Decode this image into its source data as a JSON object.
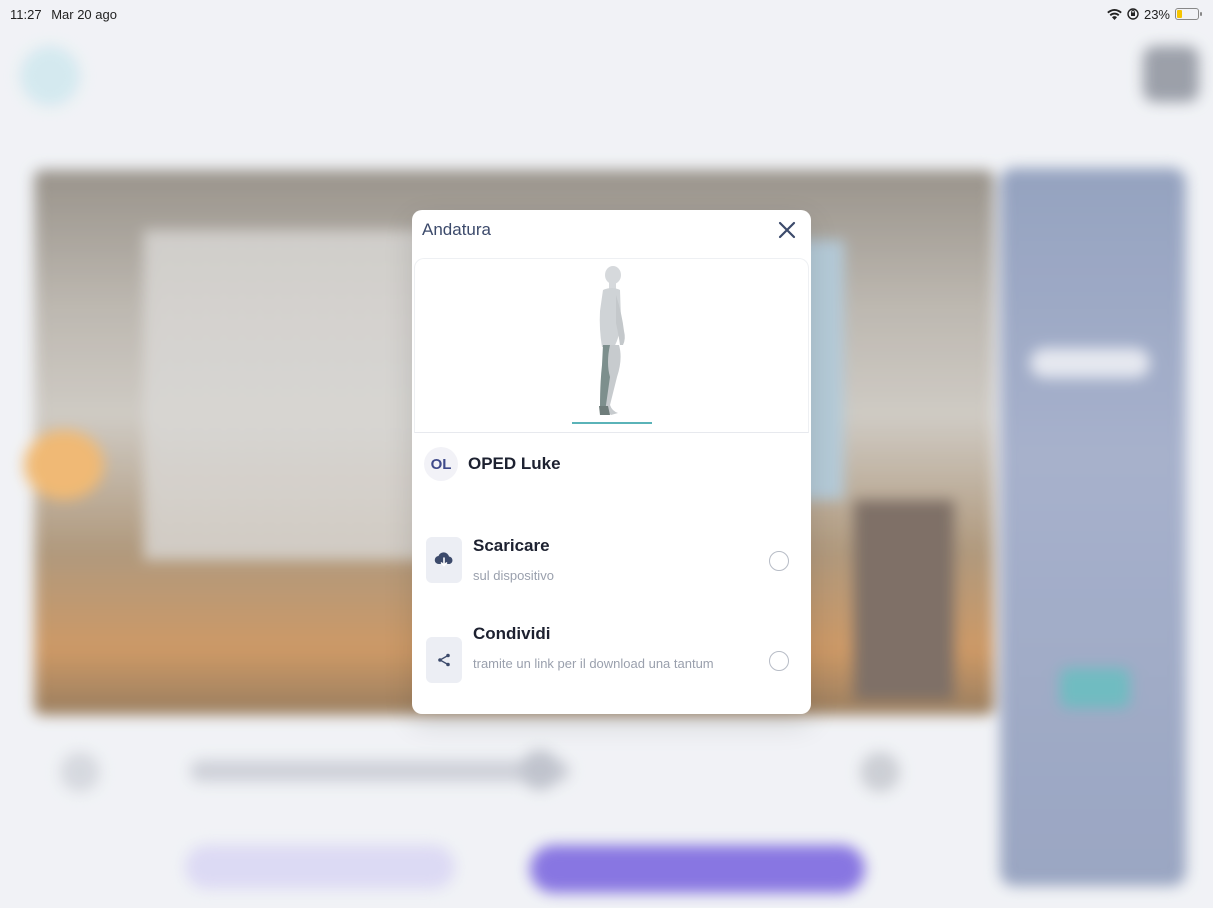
{
  "status_bar": {
    "time": "11:27",
    "date": "Mar 20 ago",
    "battery": "23%",
    "battery_level": 0.23
  },
  "modal": {
    "title": "Andatura",
    "close_icon": "close-icon",
    "user": {
      "initials": "OL",
      "name": "OPED Luke"
    },
    "options": [
      {
        "icon": "cloud-download-icon",
        "title": "Scaricare",
        "subtitle": "sul dispositivo",
        "selected": false
      },
      {
        "icon": "share-icon",
        "title": "Condividi",
        "subtitle": "tramite un link per il download una tantum",
        "selected": false
      }
    ]
  },
  "colors": {
    "accent": "#7661de",
    "teal": "#5ab3b8",
    "title": "#3c4a6b"
  }
}
